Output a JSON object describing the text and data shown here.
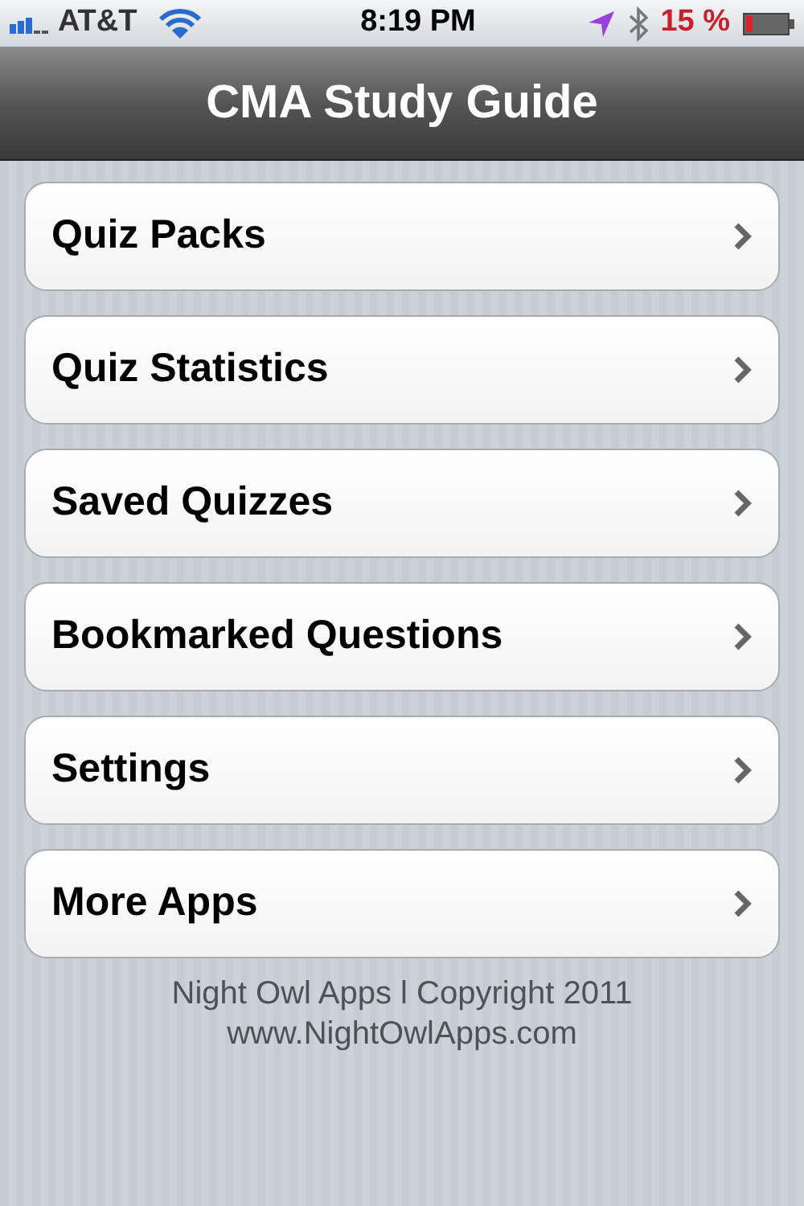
{
  "status_bar": {
    "carrier": "AT&T",
    "time": "8:19 PM",
    "battery": "15 %"
  },
  "nav_bar": {
    "title": "CMA Study Guide"
  },
  "menu": [
    {
      "label": "Quiz Packs"
    },
    {
      "label": "Quiz Statistics"
    },
    {
      "label": "Saved Quizzes"
    },
    {
      "label": "Bookmarked Questions"
    },
    {
      "label": "Settings"
    },
    {
      "label": "More Apps"
    }
  ],
  "footer": [
    "Night Owl Apps l Copyright 2011",
    "www.NightOwlApps.com"
  ]
}
